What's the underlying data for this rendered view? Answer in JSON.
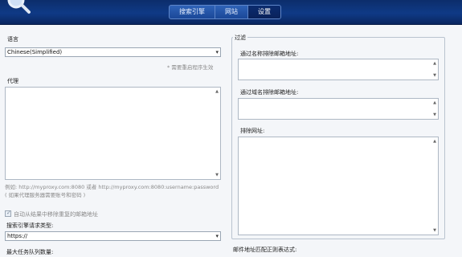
{
  "header": {
    "tabs": [
      {
        "label": "搜索引擎",
        "active": false
      },
      {
        "label": "网站",
        "active": false
      },
      {
        "label": "设置",
        "active": true
      }
    ]
  },
  "left": {
    "language_label": "语言",
    "language_value": "Chinese(Simplified)",
    "restart_hint": "* 需要重启程序生效",
    "proxy_label": "代理",
    "proxy_example": "例如: http://myproxy.com:8080 或者 http://myproxy.com:8080:username:password ( 如果代理服务器需要账号和密码 )",
    "auto_remove_label": "自动从结果中移除重复的邮箱地址",
    "auto_remove_checked": true,
    "engine_request_type_label": "搜索引擎请求类型:",
    "engine_request_type_value": "https://",
    "max_queue_label": "最大任务队列数量:"
  },
  "right": {
    "filter_legend": "过滤",
    "exclude_by_name_label": "通过名称排除邮箱地址:",
    "exclude_by_domain_label": "通过域名排除邮箱地址:",
    "exclude_urls_label": "排除网址:",
    "email_regex_label": "邮件地址匹配正则表达式:"
  },
  "colors": {
    "header_blue": "#0f3a86",
    "tab_active": "#0b2c70",
    "page_bg": "#f4f6f9"
  },
  "icons": [
    "magnifier-icon",
    "dropdown-arrow-icon",
    "scroll-up-icon",
    "scroll-down-icon",
    "checkbox-check-icon"
  ]
}
